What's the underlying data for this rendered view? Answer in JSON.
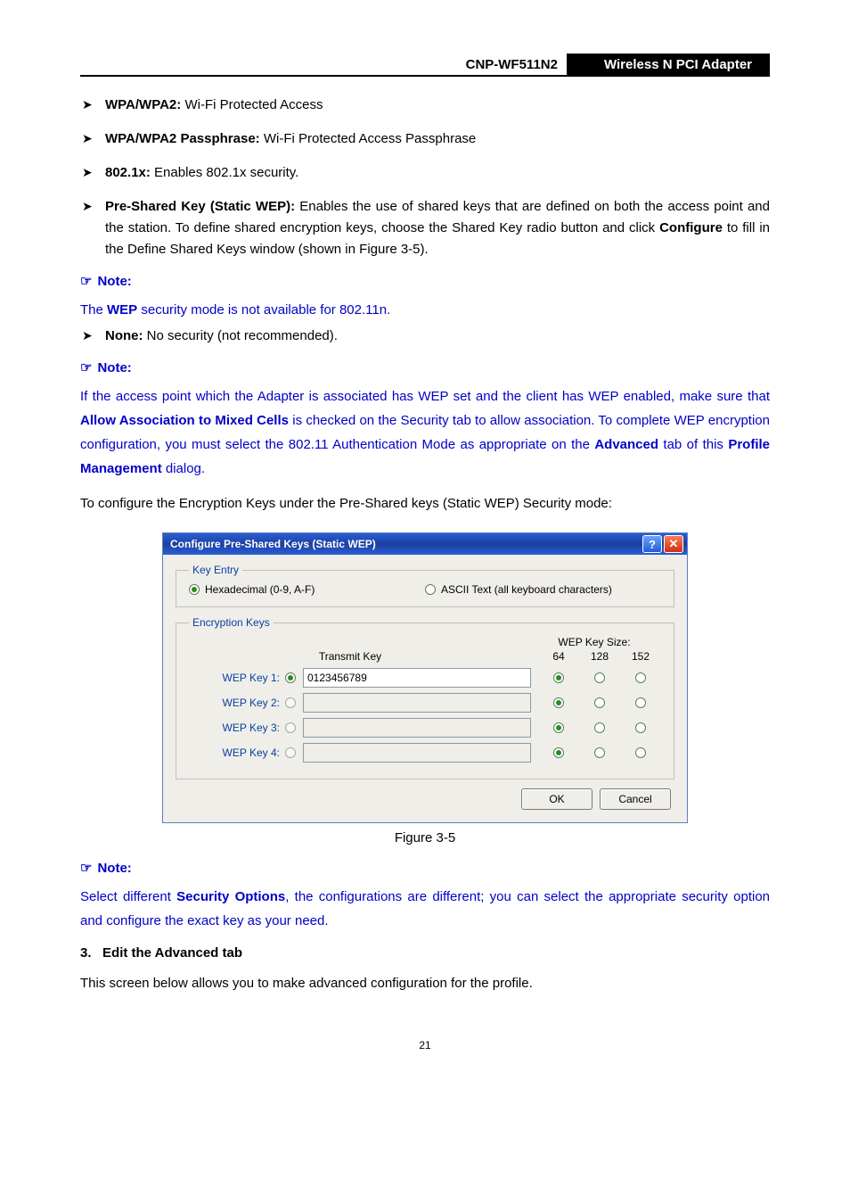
{
  "header": {
    "model": "CNP-WF511N2",
    "product": "Wireless N PCI Adapter"
  },
  "bullets1": [
    {
      "label": "WPA/WPA2:",
      "text": " Wi-Fi Protected Access"
    },
    {
      "label": "WPA/WPA2 Passphrase:",
      "text": " Wi-Fi Protected Access Passphrase"
    },
    {
      "label": "802.1x:",
      "text": " Enables 802.1x security."
    },
    {
      "label": "Pre-Shared Key (Static WEP):",
      "text": " Enables the use of shared keys that are defined on both the access point and the station. To define shared encryption keys, choose the Shared Key radio button and click ",
      "inline_bold": "Configure",
      "text2": " to fill in the Define Shared Keys window (shown in Figure 3-5)."
    }
  ],
  "note_label": "Note:",
  "note1_intro_a": "The ",
  "note1_intro_bold": "WEP",
  "note1_intro_b": " security mode is not available for 802.11n.",
  "none_bullet": {
    "label": "None:",
    "text": " No security (not recommended)."
  },
  "note2_a": "If the access point which the Adapter is associated has WEP set and the client has WEP enabled, make sure that ",
  "note2_b1": "Allow Association to Mixed Cells",
  "note2_c": " is checked on the Security tab to allow association. To complete WEP encryption configuration, you must select the 802.11 Authentication Mode as appropriate on the ",
  "note2_b2": "Advanced",
  "note2_d": " tab of this ",
  "note2_b3": "Profile Management",
  "note2_e": " dialog.",
  "para_preconfig": "To configure the Encryption Keys under the Pre-Shared keys (Static WEP) Security mode:",
  "dialog": {
    "title": "Configure Pre-Shared Keys (Static WEP)",
    "key_entry_legend": "Key Entry",
    "hex_label": "Hexadecimal (0-9, A-F)",
    "ascii_label": "ASCII Text (all keyboard characters)",
    "enc_legend": "Encryption Keys",
    "transmit_label": "Transmit Key",
    "wep_size_label": "WEP Key Size:",
    "size64": "64",
    "size128": "128",
    "size152": "152",
    "keys": [
      {
        "label": "WEP Key 1:",
        "value": "0123456789",
        "transmit": true,
        "enabled": true
      },
      {
        "label": "WEP Key 2:",
        "value": "",
        "transmit": false,
        "enabled": false
      },
      {
        "label": "WEP Key 3:",
        "value": "",
        "transmit": false,
        "enabled": false
      },
      {
        "label": "WEP Key 4:",
        "value": "",
        "transmit": false,
        "enabled": false
      }
    ],
    "ok": "OK",
    "cancel": "Cancel"
  },
  "figure_caption": "Figure 3-5",
  "note3_a": "Select different ",
  "note3_b": "Security Options",
  "note3_c": ", the configurations are different; you can select the appropriate security option and configure the exact key as your need.",
  "section3": {
    "num": "3.",
    "title": "Edit the Advanced tab"
  },
  "para_after": "This screen below allows you to make advanced configuration for the profile.",
  "pagenum": "21"
}
